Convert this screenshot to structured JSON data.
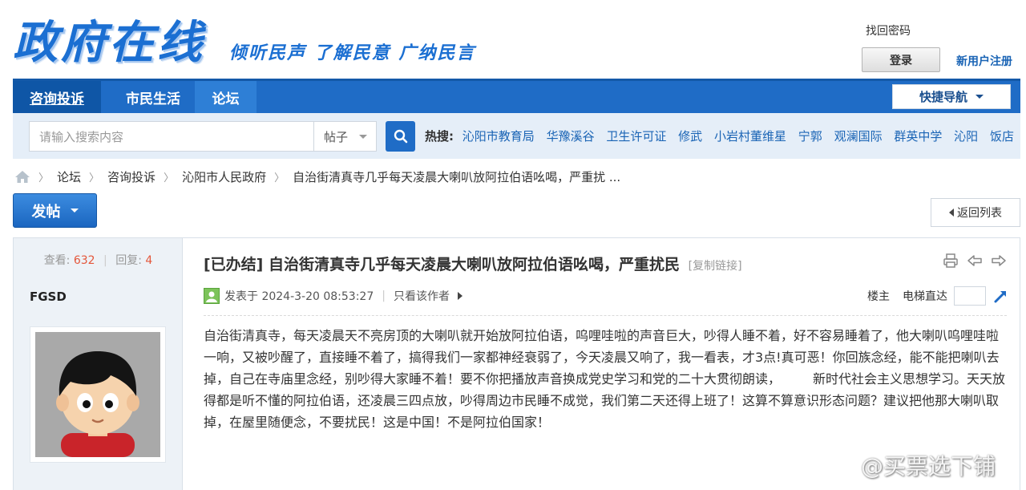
{
  "header": {
    "logo_text": "政府在线",
    "slogan": "倾听民声 了解民意 广纳民言",
    "forgot_password": "找回密码",
    "login": "登录",
    "register": "新用户注册"
  },
  "nav": {
    "items": [
      {
        "label": "咨询投诉"
      },
      {
        "label": "市民生活"
      },
      {
        "label": "论坛"
      }
    ],
    "quick_nav": "快捷导航"
  },
  "search": {
    "placeholder": "请输入搜索内容",
    "scope": "帖子",
    "hot_label": "热搜:",
    "hot_links": [
      "沁阳市教育局",
      "华豫溪谷",
      "卫生许可证",
      "修武",
      "小岩村董维星",
      "宁郭",
      "观澜国际",
      "群英中学",
      "沁阳",
      "饭店"
    ]
  },
  "breadcrumb": [
    "论坛",
    "咨询投诉",
    "沁阳市人民政府",
    "自治街清真寺几乎每天凌晨大喇叭放阿拉伯语吆喝，严重扰 ..."
  ],
  "actions": {
    "post": "发帖",
    "back": "返回列表"
  },
  "post": {
    "views_label": "查看:",
    "views": "632",
    "replies_label": "回复:",
    "replies": "4",
    "author": "FGSD",
    "title": "[已办结] 自治街清真寺几乎每天凌晨大喇叭放阿拉伯语吆喝，严重扰民",
    "copy_link": "[复制链接]",
    "posted_at": "发表于 2024-3-20 08:53:27",
    "only_author": "只看该作者",
    "floor_label": "楼主",
    "elevator": "电梯直达",
    "body": "自治街清真寺，每天凌晨天不亮房顶的大喇叭就开始放阿拉伯语，呜哩哇啦的声音巨大，吵得人睡不着，好不容易睡着了，他大喇叭呜哩哇啦一响，又被吵醒了，直接睡不着了，搞得我们一家都神经衰弱了，今天凌晨又响了，我一看表，才3点!真可恶！你回族念经，能不能把喇叭去掉，自己在寺庙里念经，别吵得大家睡不着！要不你把播放声音换成党史学习和党的二十大贯彻朗读，　　　新时代社会主义思想学习。天天放得都是听不懂的阿拉伯语，还凌晨三四点放，吵得周边市民睡不成觉，我们第二天还得上班了！这算不算意识形态问题？建议把他那大喇叭取掉，在屋里随便念，不要扰民！这是中国！不是阿拉伯国家！"
  },
  "watermark": "@买票选下铺"
}
